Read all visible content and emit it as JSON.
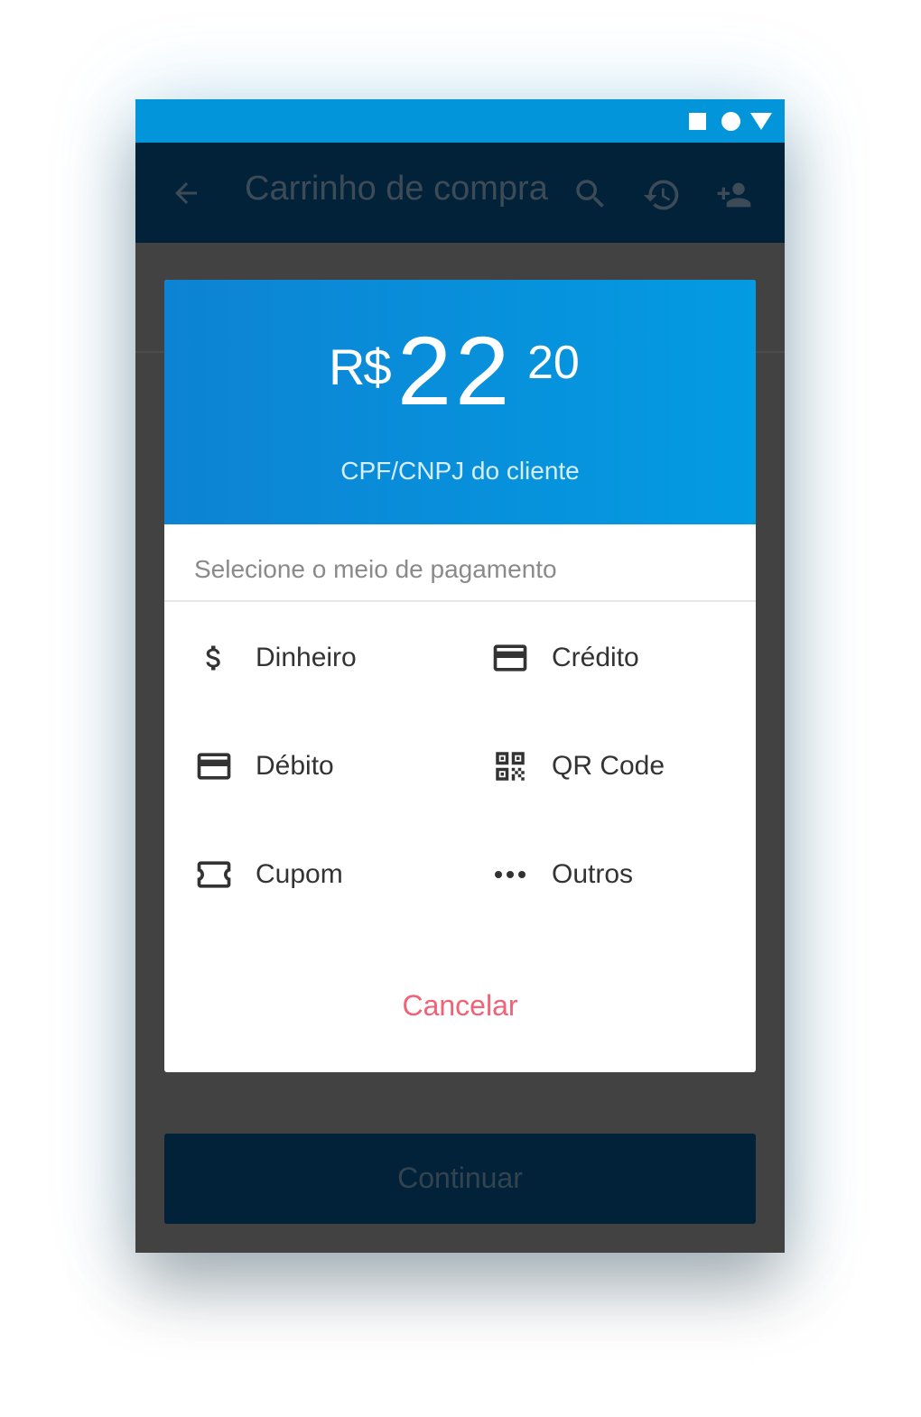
{
  "status_bar": {
    "icons": [
      "square-icon",
      "circle-icon",
      "triangle-icon"
    ],
    "background": "#0295d9"
  },
  "app_bar": {
    "title": "Carrinho de compra",
    "icons": [
      "back-arrow-icon",
      "search-icon",
      "history-icon",
      "add-user-icon"
    ],
    "background": "#02223a"
  },
  "dialog": {
    "price": {
      "currency": "R$",
      "integer": "22",
      "cents": "20"
    },
    "customer_id_label": "CPF/CNPJ do cliente",
    "select_label": "Selecione o meio de pagamento",
    "payment_options": [
      {
        "label": "Dinheiro",
        "icon": "dollar-icon"
      },
      {
        "label": "Crédito",
        "icon": "credit-card-icon"
      },
      {
        "label": "Débito",
        "icon": "debit-card-icon"
      },
      {
        "label": "QR Code",
        "icon": "qr-code-icon"
      },
      {
        "label": "Cupom",
        "icon": "coupon-ticket-icon"
      },
      {
        "label": "Outros",
        "icon": "more-dots-icon"
      }
    ],
    "cancel_label": "Cancelar",
    "colors": {
      "header_gradient_start": "#0d83d3",
      "header_gradient_end": "#039be2",
      "cancel": "#f26175"
    }
  },
  "continue_label": "Continuar"
}
